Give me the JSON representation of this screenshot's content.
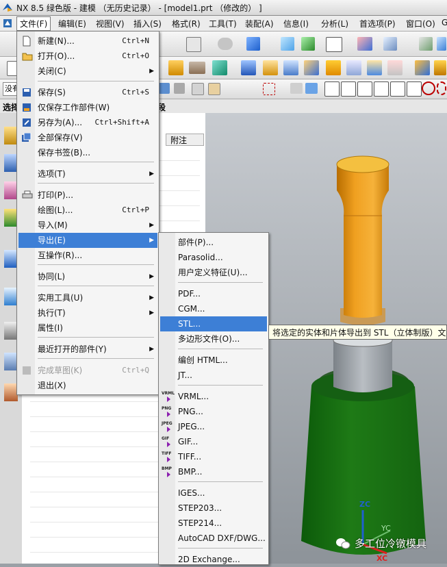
{
  "window": {
    "title": "NX 8.5 绿色版 - 建模 （无历史记录） - [model1.prt （修改的） ]"
  },
  "menubar": [
    "文件(F)",
    "编辑(E)",
    "视图(V)",
    "插入(S)",
    "格式(R)",
    "工具(T)",
    "装配(A)",
    "信息(I)",
    "分析(L)",
    "首选项(P)",
    "窗口(O)",
    "G"
  ],
  "selection_bar": {
    "filter_value": "没有",
    "label": "选择",
    "tail": "段"
  },
  "nav": {
    "column_header": "附注"
  },
  "file_menu": [
    {
      "label": "新建(N)...",
      "shortcut": "Ctrl+N"
    },
    {
      "label": "打开(O)...",
      "shortcut": "Ctrl+O"
    },
    {
      "label": "关闭(C)",
      "arrow": "▶"
    },
    {
      "label": "保存(S)",
      "shortcut": "Ctrl+S"
    },
    {
      "label": "仅保存工作部件(W)"
    },
    {
      "label": "另存为(A)...",
      "shortcut": "Ctrl+Shift+A"
    },
    {
      "label": "全部保存(V)"
    },
    {
      "label": "保存书签(B)..."
    },
    {
      "label": "选项(T)",
      "arrow": "▶"
    },
    {
      "label": "打印(P)..."
    },
    {
      "label": "绘图(L)...",
      "shortcut": "Ctrl+P"
    },
    {
      "label": "导入(M)",
      "arrow": "▶"
    },
    {
      "label": "导出(E)",
      "arrow": "▶"
    },
    {
      "label": "互操作(R)..."
    },
    {
      "label": "协同(L)",
      "arrow": "▶"
    },
    {
      "label": "实用工具(U)",
      "arrow": "▶"
    },
    {
      "label": "执行(T)",
      "arrow": "▶"
    },
    {
      "label": "属性(I)"
    },
    {
      "label": "最近打开的部件(Y)",
      "arrow": "▶"
    },
    {
      "label": "完成草图(K)",
      "shortcut": "Ctrl+Q"
    },
    {
      "label": "退出(X)"
    }
  ],
  "export_menu": [
    {
      "label": "部件(P)..."
    },
    {
      "label": "Parasolid..."
    },
    {
      "label": "用户定义特征(U)..."
    },
    {
      "label": "PDF..."
    },
    {
      "label": "CGM..."
    },
    {
      "label": "STL..."
    },
    {
      "label": "多边形文件(O)..."
    },
    {
      "label": "编创 HTML..."
    },
    {
      "label": "JT..."
    },
    {
      "label": "VRML...",
      "format": "VRML"
    },
    {
      "label": "PNG...",
      "format": "PNG"
    },
    {
      "label": "JPEG...",
      "format": "JPEG"
    },
    {
      "label": "GIF...",
      "format": "GIF"
    },
    {
      "label": "TIFF...",
      "format": "TIFF"
    },
    {
      "label": "BMP...",
      "format": "BMP"
    },
    {
      "label": "IGES..."
    },
    {
      "label": "STEP203..."
    },
    {
      "label": "STEP214..."
    },
    {
      "label": "AutoCAD DXF/DWG..."
    },
    {
      "label": "2D Exchange..."
    }
  ],
  "tooltip": "将选定的实体和片体导出到 STL（立体制版）文件",
  "triad": {
    "z": "ZC",
    "y": "YC",
    "x": "XC"
  },
  "watermark": "多工位冷镦模具",
  "colors": {
    "highlight": "#3d7fd6",
    "model_orange": "#f0a020",
    "model_green": "#1e7a16"
  }
}
